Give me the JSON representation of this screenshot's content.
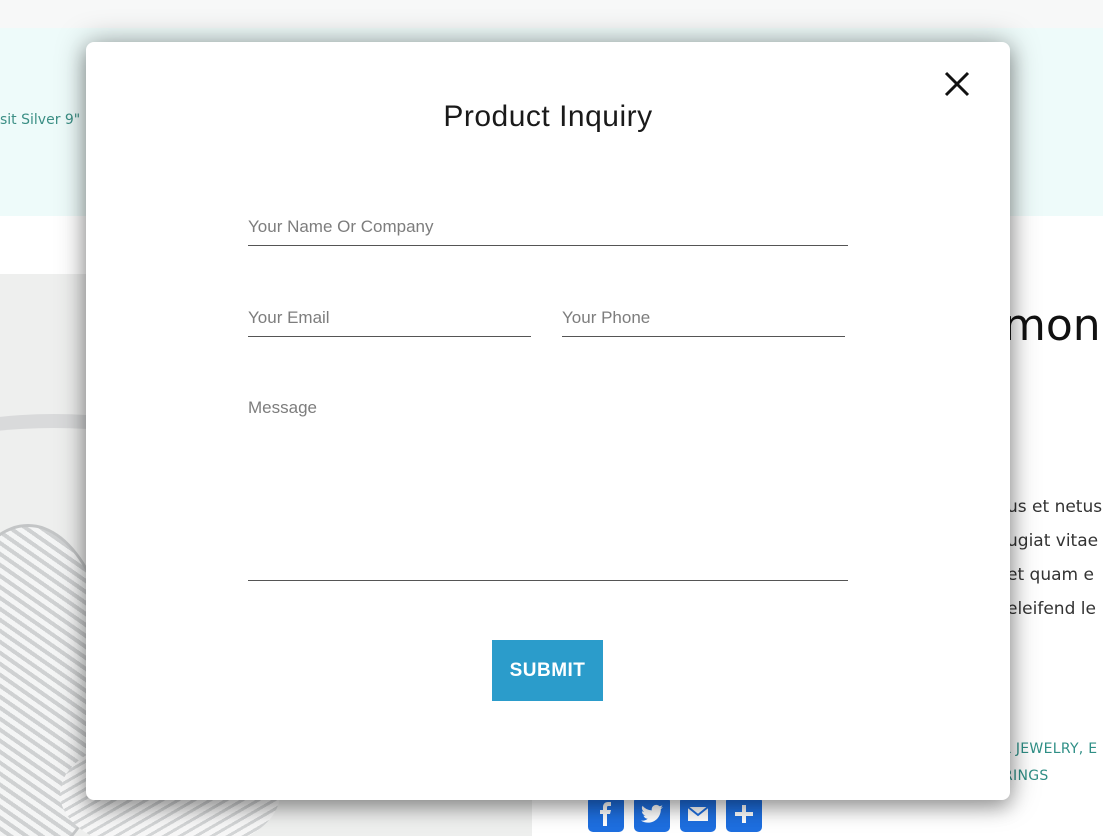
{
  "background": {
    "breadcrumb_fragment": "sit Silver 9\"",
    "product_title_fragment": "mond",
    "description_lines": [
      "us et netus",
      "ugiat vitae",
      "et quam e",
      "eleifend le"
    ],
    "categories_line1": "L JEWELRY, E",
    "categories_line2": "RINGS",
    "share_icons": [
      "facebook-icon",
      "twitter-icon",
      "email-icon",
      "share-plus-icon"
    ],
    "colors": {
      "banner": "#eefbfa",
      "link": "#3b8f85",
      "share": "#1e6fe0"
    }
  },
  "modal": {
    "title": "Product Inquiry",
    "close_icon": "close-icon",
    "form": {
      "name_placeholder": "Your Name Or Company",
      "email_placeholder": "Your Email",
      "phone_placeholder": "Your Phone",
      "message_placeholder": "Message",
      "submit_label": "SUBMIT"
    },
    "colors": {
      "submit_bg": "#2b9ccb",
      "submit_text": "#ffffff"
    }
  }
}
